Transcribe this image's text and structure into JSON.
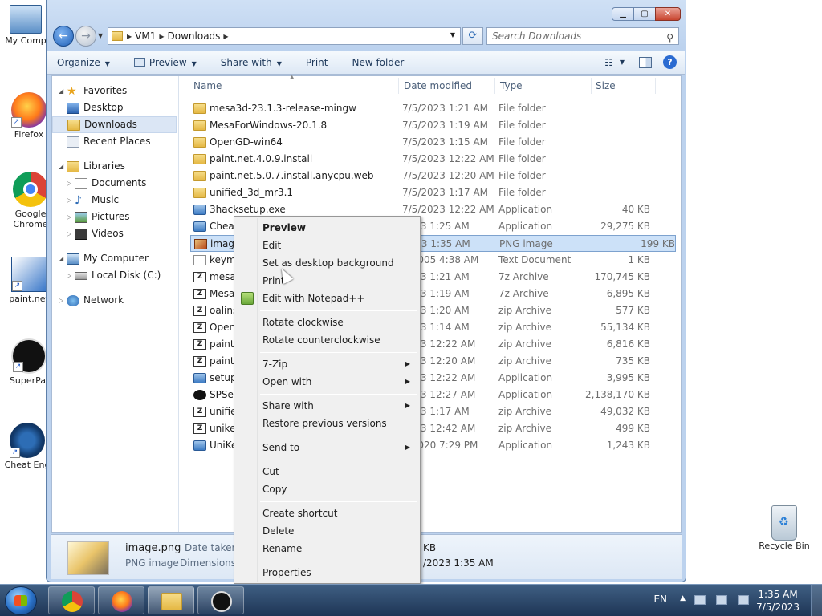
{
  "desktop": {
    "icons": [
      {
        "label": "My Comp"
      },
      {
        "label": "Firefox"
      },
      {
        "label": "Google Chrome"
      },
      {
        "label": "paint.net"
      },
      {
        "label": "SuperPai"
      },
      {
        "label": "Cheat Eng"
      }
    ],
    "recycle_bin": "Recycle Bin"
  },
  "window": {
    "address": {
      "crumbs": [
        "VM1",
        "Downloads"
      ]
    },
    "search_placeholder": "Search Downloads",
    "toolbar": {
      "organize": "Organize",
      "preview": "Preview",
      "share_with": "Share with",
      "print": "Print",
      "new_folder": "New folder"
    }
  },
  "nav": {
    "favorites": "Favorites",
    "desktop": "Desktop",
    "downloads": "Downloads",
    "recent_places": "Recent Places",
    "libraries": "Libraries",
    "documents": "Documents",
    "music": "Music",
    "pictures": "Pictures",
    "videos": "Videos",
    "my_computer": "My Computer",
    "local_disk": "Local Disk (C:)",
    "network": "Network"
  },
  "columns": {
    "name": "Name",
    "date": "Date modified",
    "type": "Type",
    "size": "Size"
  },
  "files": [
    {
      "icon": "folder-icon",
      "name": "mesa3d-23.1.3-release-mingw",
      "date": "7/5/2023 1:21 AM",
      "type": "File folder",
      "size": ""
    },
    {
      "icon": "folder-icon",
      "name": "MesaForWindows-20.1.8",
      "date": "7/5/2023 1:19 AM",
      "type": "File folder",
      "size": ""
    },
    {
      "icon": "folder-icon",
      "name": "OpenGD-win64",
      "date": "7/5/2023 1:15 AM",
      "type": "File folder",
      "size": ""
    },
    {
      "icon": "folder-icon",
      "name": "paint.net.4.0.9.install",
      "date": "7/5/2023 12:22 AM",
      "type": "File folder",
      "size": ""
    },
    {
      "icon": "folder-icon",
      "name": "paint.net.5.0.7.install.anycpu.web",
      "date": "7/5/2023 12:20 AM",
      "type": "File folder",
      "size": ""
    },
    {
      "icon": "folder-icon",
      "name": "unified_3d_mr3.1",
      "date": "7/5/2023 1:17 AM",
      "type": "File folder",
      "size": ""
    },
    {
      "icon": "app-icon",
      "name": "3hacksetup.exe",
      "date": "7/5/2023 12:22 AM",
      "type": "Application",
      "size": "40 KB"
    },
    {
      "icon": "app-icon",
      "name": "Cheat",
      "date": "2023 1:25 AM",
      "type": "Application",
      "size": "29,275 KB"
    },
    {
      "icon": "png-icon",
      "name": "image",
      "date": "2023 1:35 AM",
      "type": "PNG image",
      "size": "199 KB"
    },
    {
      "icon": "text-doc-icon",
      "name": "keym",
      "date": "9/2005 4:38 AM",
      "type": "Text Document",
      "size": "1 KB"
    },
    {
      "icon": "7z-icon",
      "name": "mesa3",
      "date": "2023 1:21 AM",
      "type": "7z Archive",
      "size": "170,745 KB"
    },
    {
      "icon": "7z-icon",
      "name": "Mesal",
      "date": "2023 1:19 AM",
      "type": "7z Archive",
      "size": "6,895 KB"
    },
    {
      "icon": "zip-icon",
      "name": "oalins",
      "date": "2023 1:20 AM",
      "type": "zip Archive",
      "size": "577 KB"
    },
    {
      "icon": "zip-icon",
      "name": "Open",
      "date": "2023 1:14 AM",
      "type": "zip Archive",
      "size": "55,134 KB"
    },
    {
      "icon": "zip-icon",
      "name": "paint.",
      "date": "2023 12:22 AM",
      "type": "zip Archive",
      "size": "6,816 KB"
    },
    {
      "icon": "zip-icon",
      "name": "paint.",
      "date": "2023 12:20 AM",
      "type": "zip Archive",
      "size": "735 KB"
    },
    {
      "icon": "app-icon",
      "name": "setup",
      "date": "2023 12:22 AM",
      "type": "Application",
      "size": "3,995 KB"
    },
    {
      "icon": "dark-app-icon",
      "name": "SPSet",
      "date": "2023 12:27 AM",
      "type": "Application",
      "size": "2,138,170 KB"
    },
    {
      "icon": "zip-icon",
      "name": "unifie",
      "date": "2023 1:17 AM",
      "type": "zip Archive",
      "size": "49,032 KB"
    },
    {
      "icon": "zip-icon",
      "name": "unike",
      "date": "2023 12:42 AM",
      "type": "zip Archive",
      "size": "499 KB"
    },
    {
      "icon": "app-icon",
      "name": "UniKe",
      "date": "4/2020 7:29 PM",
      "type": "Application",
      "size": "1,243 KB"
    }
  ],
  "details": {
    "name": "image.png",
    "type": "PNG image",
    "date_taken_label": "Date taken:",
    "dimensions_label": "Dimensions:",
    "size_tail": "KB",
    "date_tail": "/2023 1:35 AM"
  },
  "context_menu": {
    "preview": "Preview",
    "edit": "Edit",
    "set_bg": "Set as desktop background",
    "print": "Print",
    "edit_notepad": "Edit with Notepad++",
    "rotate_cw": "Rotate clockwise",
    "rotate_ccw": "Rotate counterclockwise",
    "zip": "7-Zip",
    "open_with": "Open with",
    "share_with": "Share with",
    "restore": "Restore previous versions",
    "send_to": "Send to",
    "cut": "Cut",
    "copy": "Copy",
    "create_shortcut": "Create shortcut",
    "delete": "Delete",
    "rename": "Rename",
    "properties": "Properties"
  },
  "taskbar": {
    "lang": "EN",
    "time": "1:35 AM",
    "date": "7/5/2023"
  },
  "colors": {
    "selection": "#cce1f8",
    "taskbar": "#1e3555",
    "accent": "#2b6bd1"
  }
}
